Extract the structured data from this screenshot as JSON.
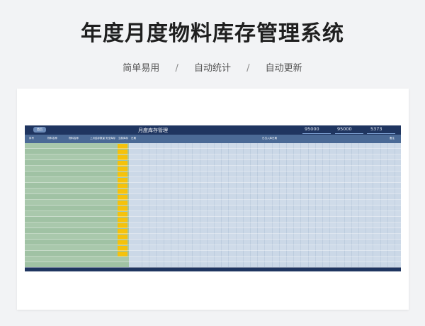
{
  "page": {
    "title": "年度月度物料库存管理系统",
    "features": [
      "简单易用",
      "自动统计",
      "自动更新"
    ],
    "separator": "/"
  },
  "sheet": {
    "button_label": "首页",
    "title": "月度库存管理",
    "stats": [
      "95000",
      "95000",
      "5373"
    ],
    "columns_left": [
      "序号",
      "物料名称",
      "物料名称",
      "上月结存数量",
      "安全库存",
      "当前库存"
    ],
    "columns_right": [
      "日期",
      "日出入库日期",
      "备注"
    ],
    "rows": 22
  }
}
